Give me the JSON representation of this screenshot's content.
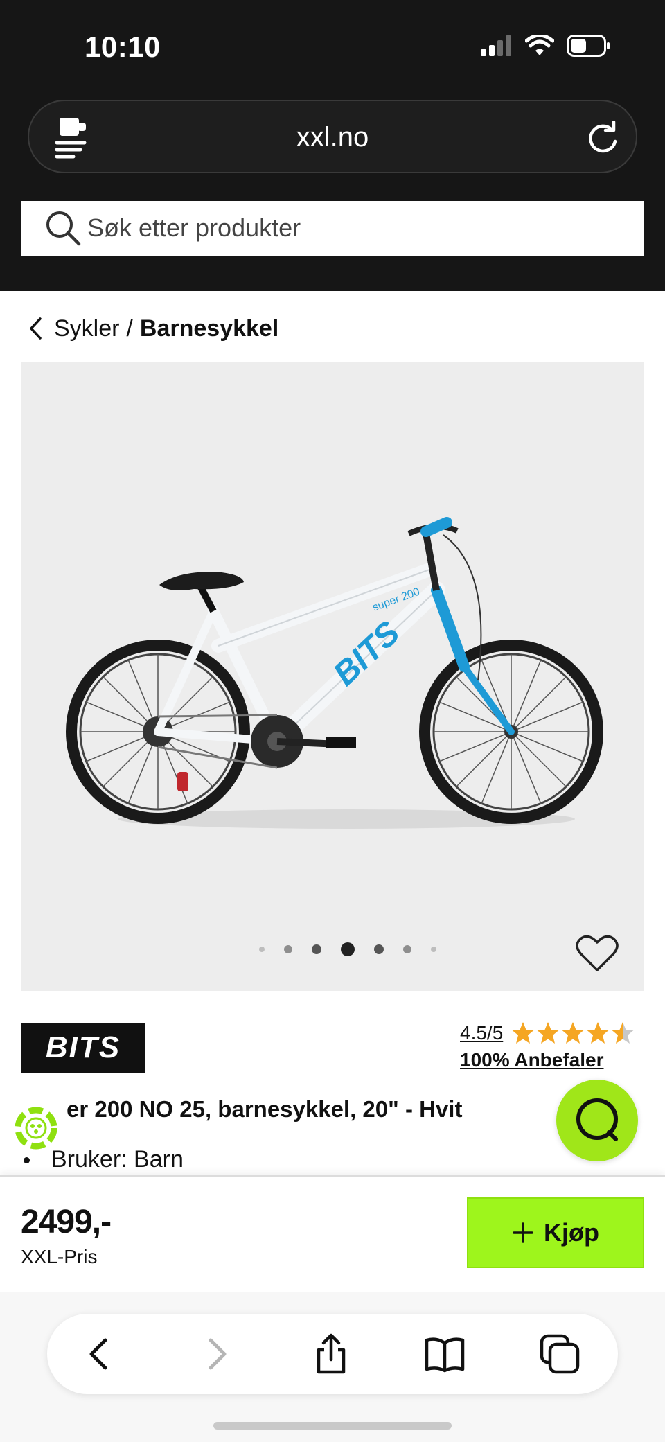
{
  "status_bar": {
    "time": "10:10"
  },
  "browser": {
    "url": "xxl.no"
  },
  "search": {
    "placeholder": "Søk etter produkter"
  },
  "breadcrumb": {
    "parent": "Sykler",
    "separator": "/",
    "current": "Barnesykkel"
  },
  "product": {
    "image_label": "BITS",
    "image_model": "super 200",
    "gallery": {
      "dot_count": 7,
      "active_index": 3
    },
    "brand": "BITS",
    "rating": "4.5/5",
    "rating_value": 4.5,
    "rating_max": 5,
    "recommend": "100% Anbefaler",
    "title": "er 200 NO 25, barnesykkel, 20\" - Hvit",
    "bullet": "Bruker: Barn"
  },
  "buy_bar": {
    "price": "2499,-",
    "price_label": "XXL-Pris",
    "buy_label": "Kjøp"
  },
  "colors": {
    "accent": "#9ef51c",
    "dark": "#161616",
    "star": "#f5a623",
    "bike_blue": "#1e9ad6"
  },
  "icons": {
    "signal": "signal-icon",
    "wifi": "wifi-icon",
    "battery": "battery-icon",
    "reload": "reload-icon",
    "search": "search-icon",
    "back": "chevron-left-icon",
    "heart": "heart-icon",
    "chat": "chat-icon",
    "plus": "plus-icon",
    "share": "share-icon",
    "bookmarks": "book-icon",
    "tabs": "tabs-icon"
  }
}
